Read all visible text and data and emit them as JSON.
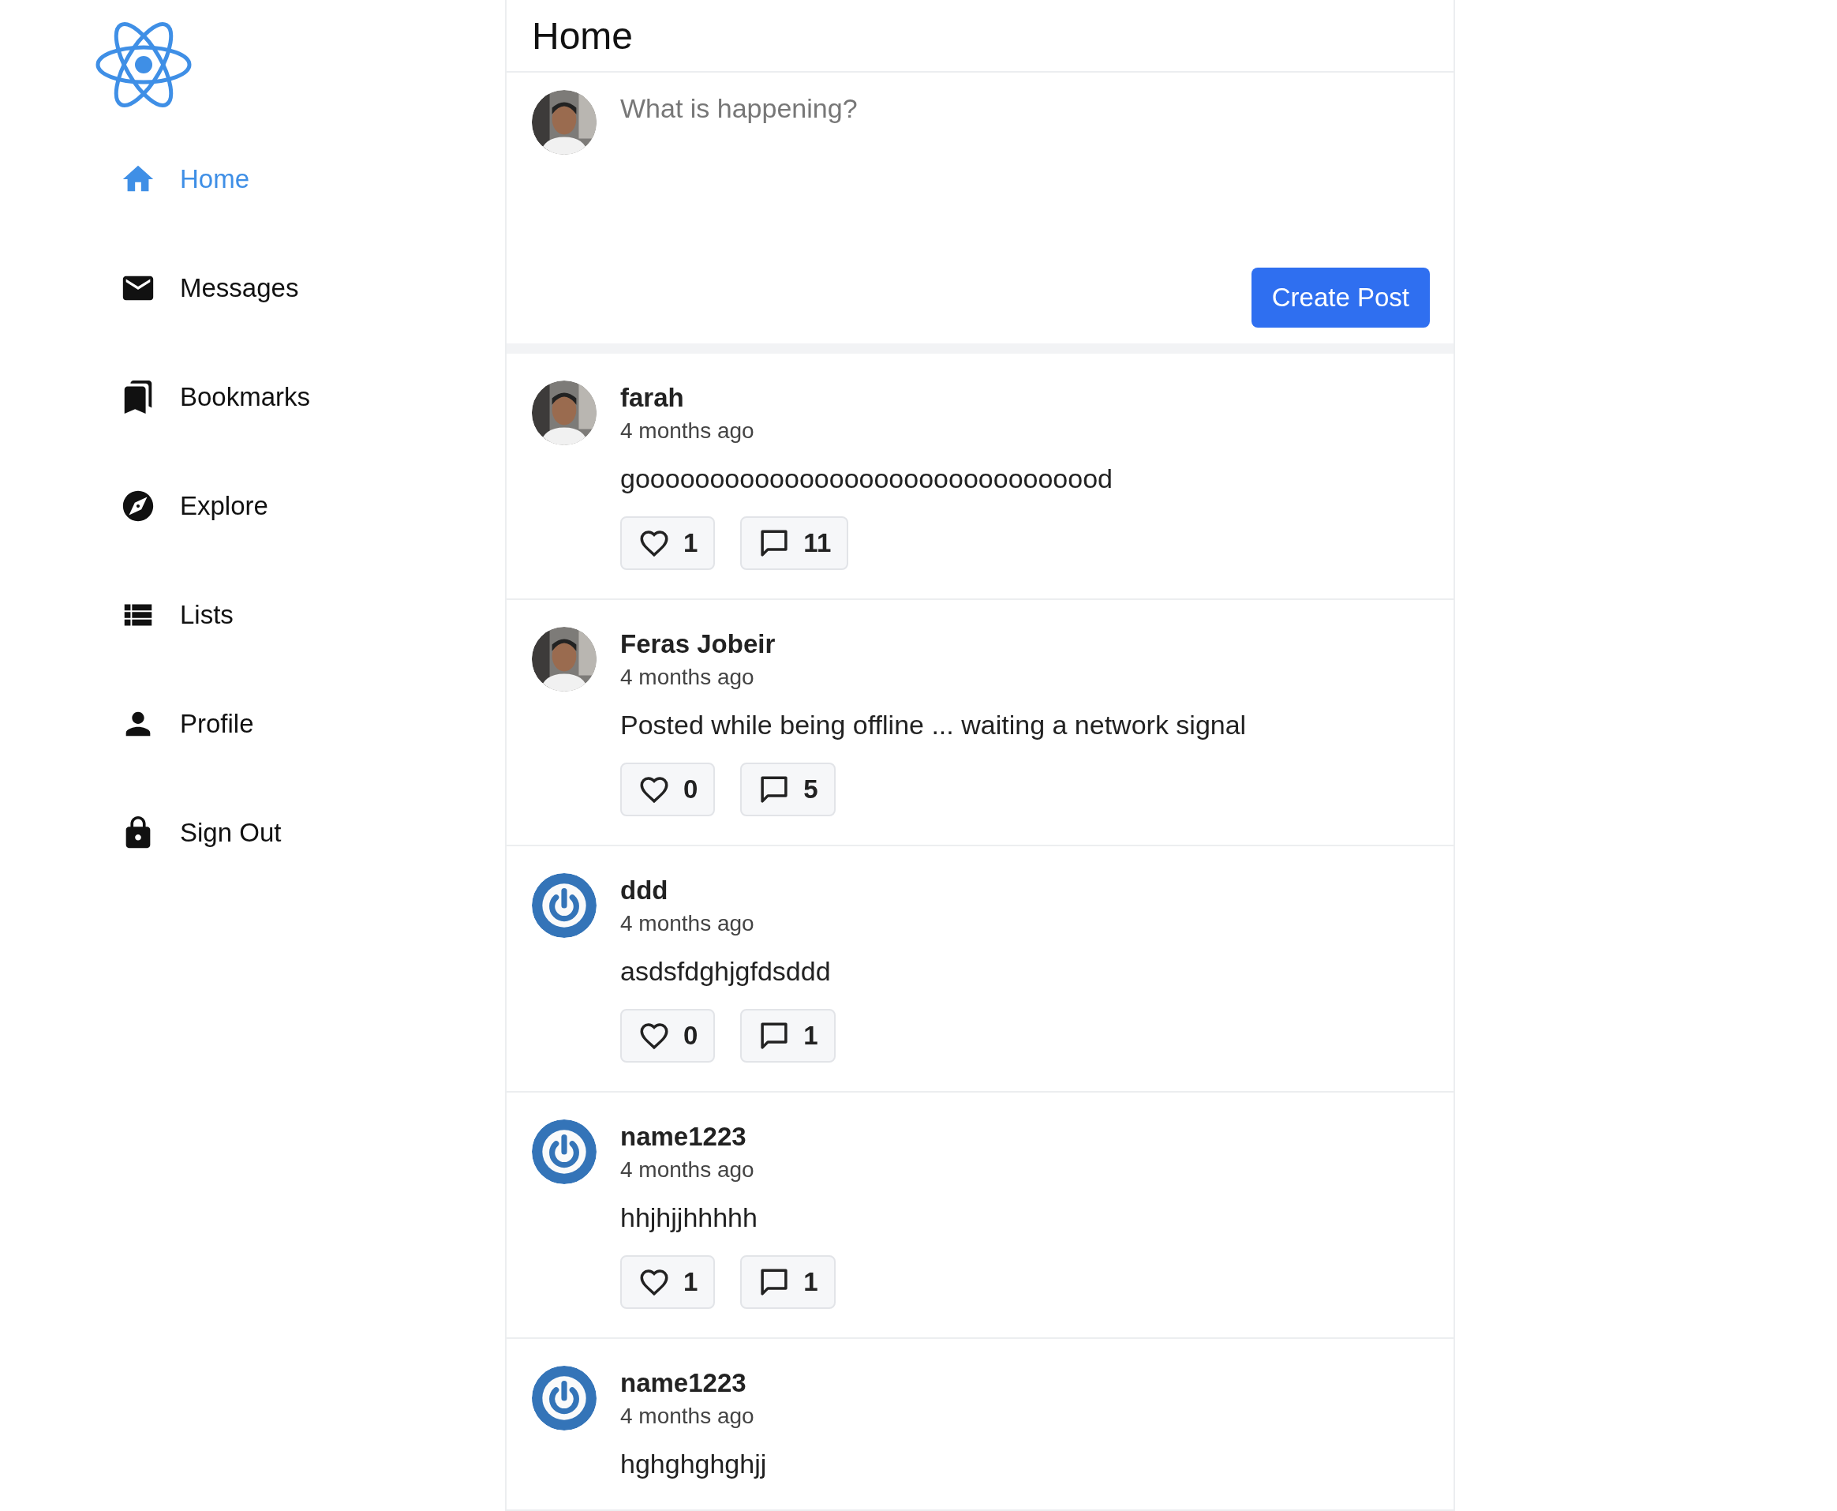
{
  "sidebar": {
    "items": [
      {
        "label": "Home",
        "kind": "home",
        "selected": true
      },
      {
        "label": "Messages",
        "kind": "mail",
        "selected": false
      },
      {
        "label": "Bookmarks",
        "kind": "bookmarks",
        "selected": false
      },
      {
        "label": "Explore",
        "kind": "compass",
        "selected": false
      },
      {
        "label": "Lists",
        "kind": "list",
        "selected": false
      },
      {
        "label": "Profile",
        "kind": "person",
        "selected": false
      },
      {
        "label": "Sign Out",
        "kind": "lock",
        "selected": false
      }
    ]
  },
  "header": {
    "title": "Home"
  },
  "composer": {
    "placeholder": "What is happening?",
    "button": "Create Post"
  },
  "posts": [
    {
      "author": "farah",
      "time": "4 months ago",
      "text": "goooooooooooooooooooooooooooooood",
      "likes": "1",
      "comments": "11"
    },
    {
      "author": "Feras Jobeir",
      "time": "4 months ago",
      "text": "Posted while being offline ... waiting a network signal",
      "likes": "0",
      "comments": "5"
    },
    {
      "author": "ddd",
      "avatar": {
        "kind": "default"
      },
      "time": "4 months ago",
      "text": "asdsfdghjgfdsddd",
      "likes": "0",
      "comments": "1"
    },
    {
      "author": "name1223",
      "avatar": {
        "kind": "default"
      },
      "time": "4 months ago",
      "text": "hhjhjjhhhhh",
      "likes": "1",
      "comments": "1"
    },
    {
      "author": "name1223",
      "avatar": {
        "kind": "default"
      },
      "time": "4 months ago",
      "text": "hghghghghjj"
    }
  ]
}
